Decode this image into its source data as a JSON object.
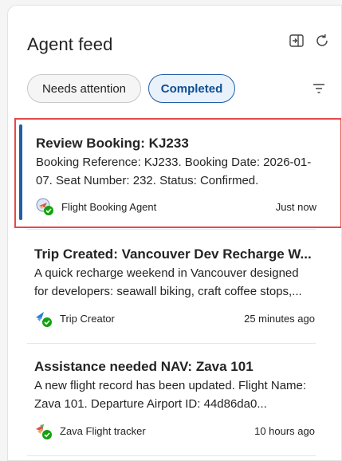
{
  "header": {
    "title": "Agent feed"
  },
  "filters": {
    "needs_attention": "Needs attention",
    "completed": "Completed"
  },
  "cards": [
    {
      "title": "Review Booking: KJ233",
      "description": "Booking Reference: KJ233. Booking Date: 2026-01-07. Seat Number: 232. Status: Confirmed.",
      "agent": "Flight Booking Agent",
      "time": "Just now"
    },
    {
      "title": "Trip Created: Vancouver Dev Recharge W...",
      "description": "A quick recharge weekend in Vancouver designed for developers: seawall biking, craft coffee stops,...",
      "agent": "Trip Creator",
      "time": "25 minutes ago"
    },
    {
      "title": "Assistance needed NAV: Zava 101",
      "description": "A new flight record has been updated. Flight Name: Zava 101. Departure Airport ID: 44d86da0...",
      "agent": "Zava Flight tracker",
      "time": "10 hours ago"
    }
  ],
  "colors": {
    "accent": "#1f5fa6",
    "selection": "#e34a4a",
    "success": "#13a10e"
  }
}
